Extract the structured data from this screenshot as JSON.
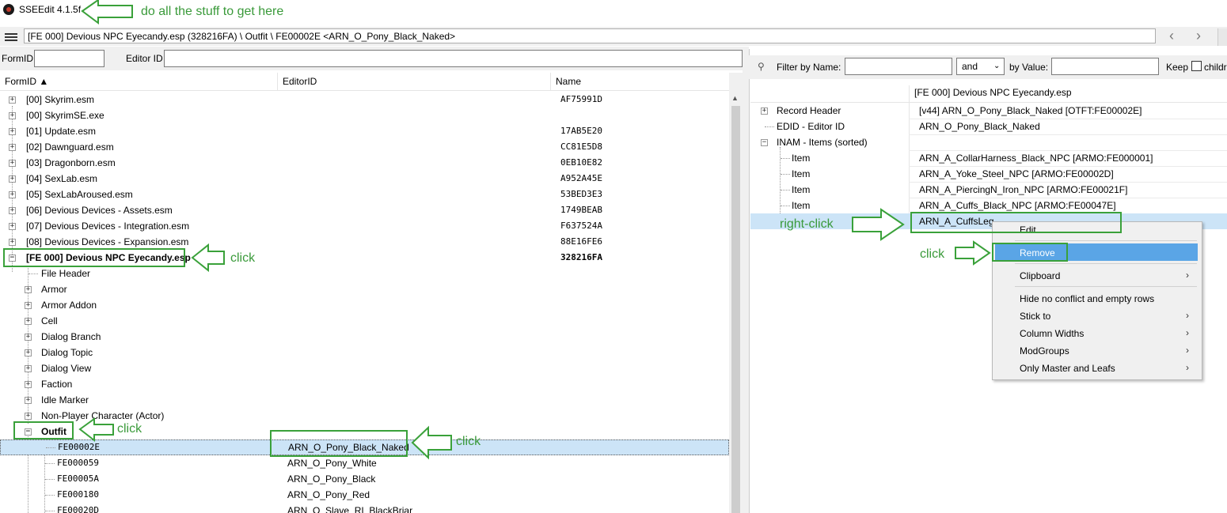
{
  "window": {
    "title": "SSEEdit 4.1.5f"
  },
  "path": {
    "value": "[FE 000] Devious NPC Eyecandy.esp (328216FA) \\ Outfit \\ FE00002E <ARN_O_Pony_Black_Naked>"
  },
  "nav": {
    "back": "‹",
    "forward": "›"
  },
  "search": {
    "formid_label": "FormID",
    "editorid_label": "Editor ID",
    "formid_value": "",
    "editorid_value": ""
  },
  "tree": {
    "columns": [
      "FormID ▲",
      "EditorID",
      "Name"
    ],
    "plugins": [
      {
        "label": "[00] Skyrim.esm",
        "hash": "AF75991D"
      },
      {
        "label": "[00] SkyrimSE.exe",
        "hash": ""
      },
      {
        "label": "[01] Update.esm",
        "hash": "17AB5E20"
      },
      {
        "label": "[02] Dawnguard.esm",
        "hash": "CC81E5D8"
      },
      {
        "label": "[03] Dragonborn.esm",
        "hash": "0EB10E82"
      },
      {
        "label": "[04] SexLab.esm",
        "hash": "A952A45E"
      },
      {
        "label": "[05] SexLabAroused.esm",
        "hash": "53BED3E3"
      },
      {
        "label": "[06] Devious Devices - Assets.esm",
        "hash": "1749BEAB"
      },
      {
        "label": "[07] Devious Devices - Integration.esm",
        "hash": "F637524A"
      },
      {
        "label": "[08] Devious Devices - Expansion.esm",
        "hash": "88E16FE6"
      }
    ],
    "active_plugin": {
      "label": "[FE 000] Devious NPC Eyecandy.esp",
      "hash": "328216FA"
    },
    "groups": [
      "File Header",
      "Armor",
      "Armor Addon",
      "Cell",
      "Dialog Branch",
      "Dialog Topic",
      "Dialog View",
      "Faction",
      "Idle Marker",
      "Non-Player Character (Actor)"
    ],
    "outfit_group": "Outfit",
    "outfits": [
      {
        "formid": "FE00002E",
        "editorid": "ARN_O_Pony_Black_Naked"
      },
      {
        "formid": "FE000059",
        "editorid": "ARN_O_Pony_White"
      },
      {
        "formid": "FE00005A",
        "editorid": "ARN_O_Pony_Black"
      },
      {
        "formid": "FE000180",
        "editorid": "ARN_O_Pony_Red"
      },
      {
        "formid": "FE00020D",
        "editorid": "ARN_O_Slave_RI_BlackBriar"
      }
    ]
  },
  "filter": {
    "by_name_label": "Filter by Name:",
    "name_value": "",
    "op_value": "and",
    "by_value_label": "by Value:",
    "value_value": "",
    "keep_label": "Keep",
    "children_label": "childr"
  },
  "record": {
    "header_col": "[FE 000] Devious NPC Eyecandy.esp",
    "rows": [
      {
        "label": "Record Header",
        "value": "[v44] ARN_O_Pony_Black_Naked [OTFT:FE00002E]"
      },
      {
        "label": "EDID - Editor ID",
        "value": "ARN_O_Pony_Black_Naked"
      },
      {
        "label": "INAM - Items (sorted)",
        "value": ""
      },
      {
        "label": "Item",
        "value": "ARN_A_CollarHarness_Black_NPC [ARMO:FE000001]"
      },
      {
        "label": "Item",
        "value": "ARN_A_Yoke_Steel_NPC [ARMO:FE00002D]"
      },
      {
        "label": "Item",
        "value": "ARN_A_PiercingN_Iron_NPC [ARMO:FE00021F]"
      },
      {
        "label": "Item",
        "value": "ARN_A_Cuffs_Black_NPC [ARMO:FE00047E]"
      },
      {
        "label": "",
        "value": "ARN_A_CuffsLeg_"
      }
    ]
  },
  "context_menu": {
    "items": [
      "Edit",
      "Remove",
      "Clipboard",
      "Hide no conflict and empty rows",
      "Stick to",
      "Column Widths",
      "ModGroups",
      "Only Master and Leafs"
    ]
  },
  "annotations": {
    "top": "do all the stuff to get here",
    "click_plugin": "click",
    "click_outfit": "click",
    "click_record": "click",
    "right_click": "right-click",
    "click_remove": "click"
  },
  "colors": {
    "annotation": "#3a9a3a",
    "selection": "#cce4f7",
    "menu_highlight": "#5aa5e6"
  }
}
